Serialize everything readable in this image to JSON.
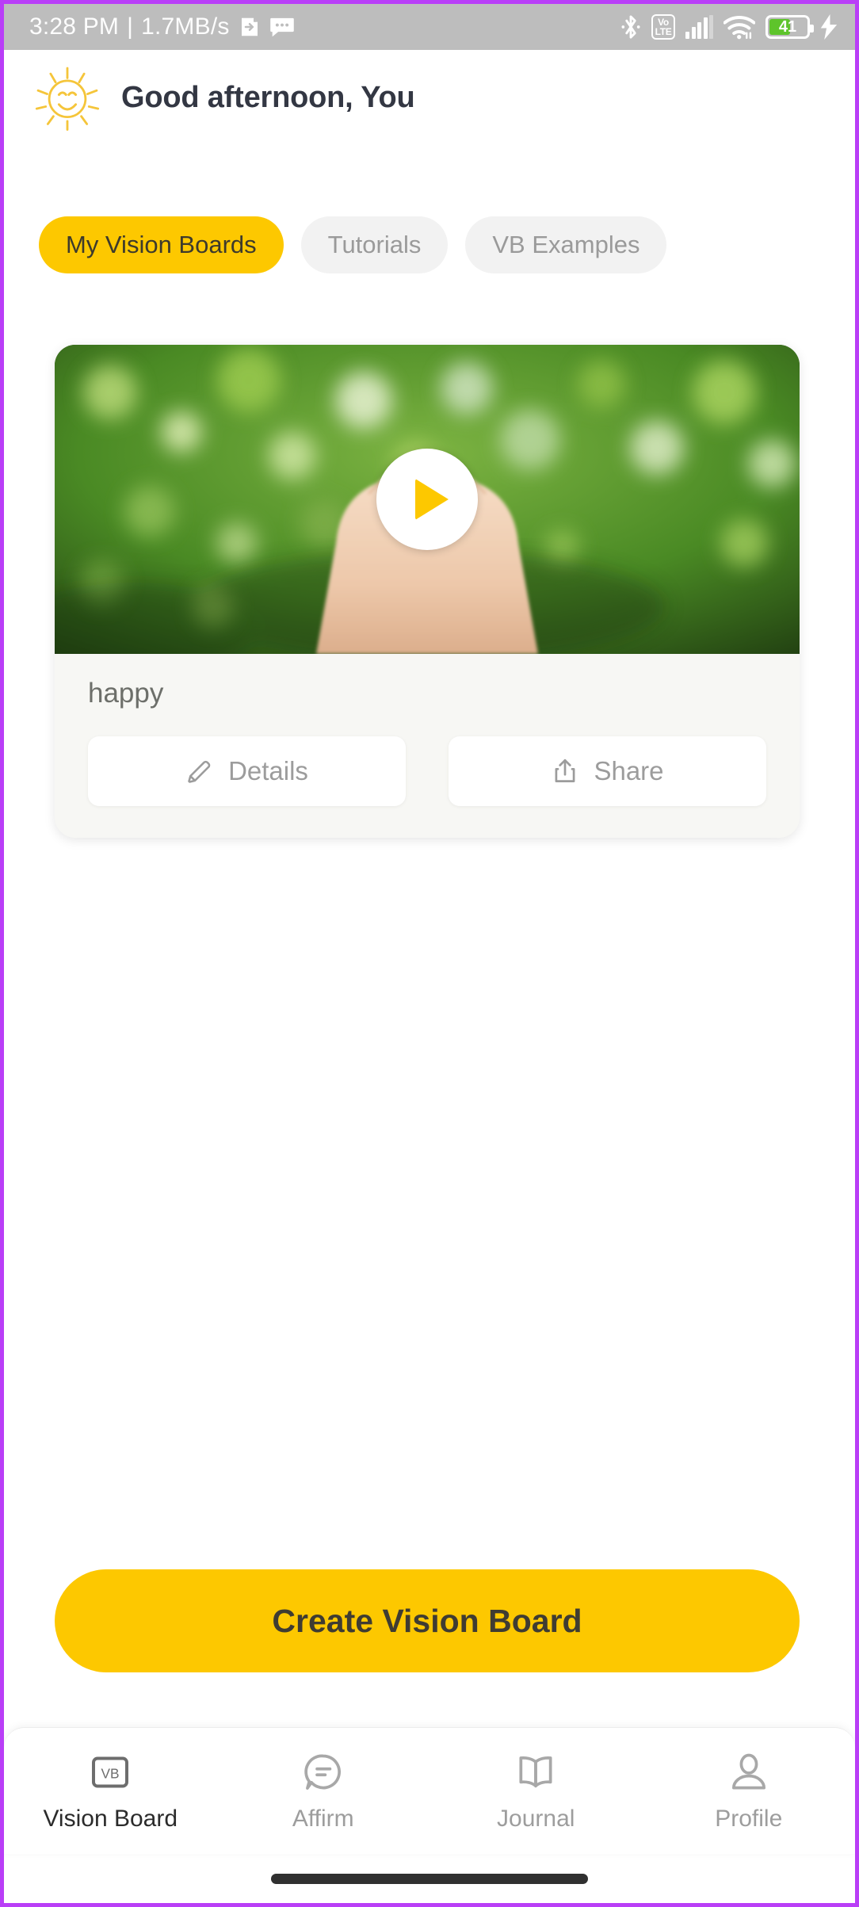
{
  "status_bar": {
    "time": "3:28 PM",
    "separator": "|",
    "network_speed": "1.7MB/s",
    "icons_left": [
      "screen-cast-icon",
      "message-icon"
    ],
    "icons_right": [
      "bluetooth-icon",
      "volte-icon",
      "cellular-signal-icon",
      "wifi-icon",
      "battery-icon",
      "charging-bolt-icon"
    ],
    "volte_top": "Vo",
    "volte_bottom": "LTE",
    "battery_percent": "41",
    "background_color": "#bdbdbd"
  },
  "header": {
    "greeting": "Good afternoon, You",
    "icon": "sun-smiling-icon"
  },
  "tabs": [
    {
      "label": "My Vision Boards",
      "active": true
    },
    {
      "label": "Tutorials",
      "active": false
    },
    {
      "label": "VB Examples",
      "active": false
    }
  ],
  "board_card": {
    "title": "happy",
    "media_type": "video-thumbnail",
    "media_description": "hands-forming-heart-over-green-bokeh-foliage",
    "play_icon": "play-icon",
    "actions": [
      {
        "label": "Details",
        "icon": "pencil-icon"
      },
      {
        "label": "Share",
        "icon": "share-icon"
      }
    ]
  },
  "primary_action": {
    "label": "Create Vision Board"
  },
  "bottom_nav": [
    {
      "label": "Vision Board",
      "icon": "vb-box-icon",
      "active": true
    },
    {
      "label": "Affirm",
      "icon": "speech-bubble-icon",
      "active": false
    },
    {
      "label": "Journal",
      "icon": "open-book-icon",
      "active": false
    },
    {
      "label": "Profile",
      "icon": "person-icon",
      "active": false
    }
  ],
  "colors": {
    "accent_yellow": "#fdc800",
    "frame_border": "#b93ef7",
    "text_dark": "#333743",
    "text_muted": "#9a9a9a",
    "card_bg": "#f7f7f4",
    "tab_inactive_bg": "#f2f2f2",
    "battery_green": "#5ec42b"
  }
}
